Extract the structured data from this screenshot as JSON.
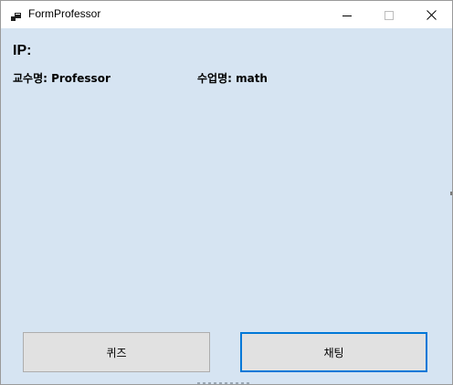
{
  "window": {
    "title": "FormProfessor",
    "icon": "app-form-icon",
    "controls": [
      "minimize-icon",
      "maximize-icon",
      "close-icon"
    ]
  },
  "form": {
    "ip_label": "IP:",
    "professor_label": "교수명: Professor",
    "class_label": "수업명: math"
  },
  "buttons": {
    "quiz": "퀴즈",
    "chat": "채팅"
  },
  "colors": {
    "client_background": "#d6e4f2",
    "focus_border": "#0078d7",
    "button_face": "#e1e1e1"
  }
}
